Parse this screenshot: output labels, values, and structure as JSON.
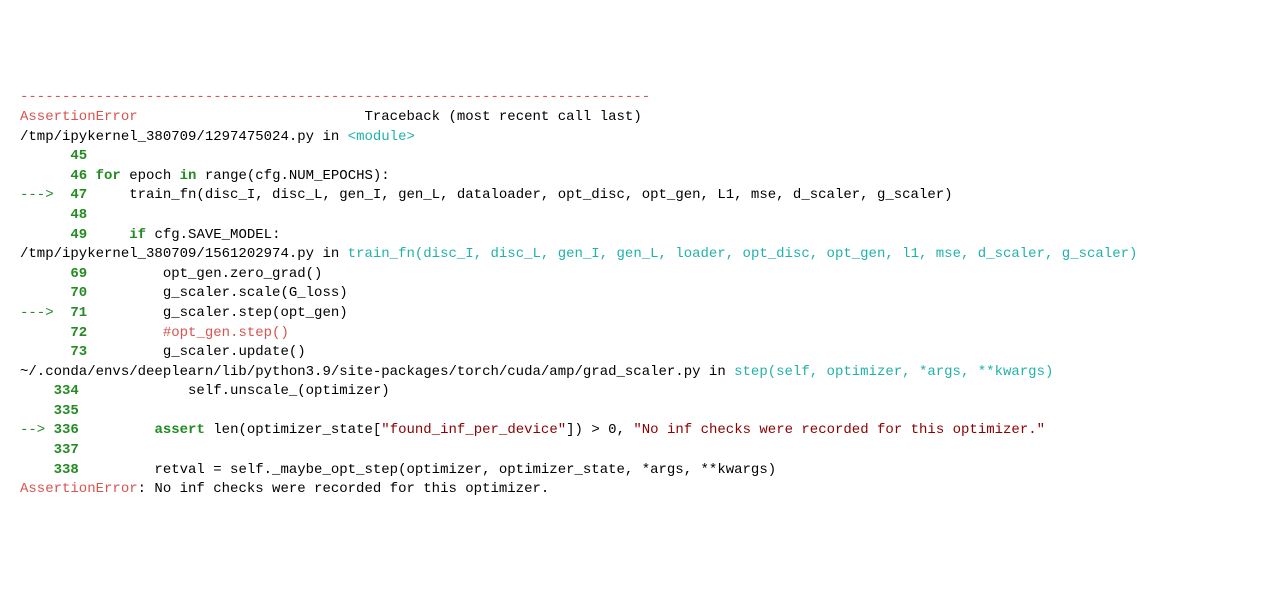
{
  "dash_line": "---------------------------------------------------------------------------",
  "header": {
    "error_name": "AssertionError",
    "spacer": "                           ",
    "traceback_label": "Traceback (most recent call last)"
  },
  "frames": [
    {
      "path": "/tmp/ipykernel_380709/1297475024.py",
      "in_word": " in ",
      "fn": "<module>",
      "lines": [
        {
          "arrow": "     ",
          "no": "45",
          "code": ""
        },
        {
          "arrow": "     ",
          "no": "46",
          "code_parts": [
            {
              "t": " ",
              "c": ""
            },
            {
              "t": "for",
              "c": "kw"
            },
            {
              "t": " epoch ",
              "c": ""
            },
            {
              "t": "in",
              "c": "kw"
            },
            {
              "t": " range(cfg.NUM_EPOCHS):",
              "c": ""
            }
          ]
        },
        {
          "arrow": "---> ",
          "no": "47",
          "code_parts": [
            {
              "t": "     train_fn(disc_I, disc_L, gen_I, gen_L, dataloader, opt_disc, opt_gen, L1, mse, d_scaler, g_scaler)",
              "c": ""
            }
          ]
        },
        {
          "arrow": "     ",
          "no": "48",
          "code": ""
        },
        {
          "arrow": "     ",
          "no": "49",
          "code_parts": [
            {
              "t": "     ",
              "c": ""
            },
            {
              "t": "if",
              "c": "kw"
            },
            {
              "t": " cfg.SAVE_MODEL:",
              "c": ""
            }
          ]
        }
      ]
    },
    {
      "path": "/tmp/ipykernel_380709/1561202974.py",
      "in_word": " in ",
      "fn": "train_fn(disc_I, disc_L, gen_I, gen_L, loader, opt_disc, opt_gen, l1, mse, d_scaler, g_scaler)",
      "lines": [
        {
          "arrow": "     ",
          "no": "69",
          "code_parts": [
            {
              "t": "         opt_gen.zero_grad()",
              "c": ""
            }
          ]
        },
        {
          "arrow": "     ",
          "no": "70",
          "code_parts": [
            {
              "t": "         g_scaler.scale(G_loss)",
              "c": ""
            }
          ]
        },
        {
          "arrow": "---> ",
          "no": "71",
          "code_parts": [
            {
              "t": "         g_scaler.step(opt_gen)",
              "c": ""
            }
          ]
        },
        {
          "arrow": "     ",
          "no": "72",
          "code_parts": [
            {
              "t": "         ",
              "c": ""
            },
            {
              "t": "#opt_gen.step()",
              "c": "comment"
            }
          ]
        },
        {
          "arrow": "     ",
          "no": "73",
          "code_parts": [
            {
              "t": "         g_scaler.update()",
              "c": ""
            }
          ]
        }
      ]
    },
    {
      "path": "~/.conda/envs/deeplearn/lib/python3.9/site-packages/torch/cuda/amp/grad_scaler.py",
      "in_word": " in ",
      "fn": "step(self, optimizer, *args, **kwargs)",
      "lines": [
        {
          "arrow": "    ",
          "no": "334",
          "code_parts": [
            {
              "t": "             self.unscale_(optimizer)",
              "c": ""
            }
          ]
        },
        {
          "arrow": "    ",
          "no": "335",
          "code_parts": [
            {
              "t": "",
              "c": ""
            }
          ]
        },
        {
          "arrow": "--> ",
          "no": "336",
          "code_parts": [
            {
              "t": "         ",
              "c": ""
            },
            {
              "t": "assert",
              "c": "kw"
            },
            {
              "t": " len(optimizer_state[",
              "c": ""
            },
            {
              "t": "\"found_inf_per_device\"",
              "c": "str"
            },
            {
              "t": "]) > ",
              "c": ""
            },
            {
              "t": "0",
              "c": "num"
            },
            {
              "t": ", ",
              "c": ""
            },
            {
              "t": "\"No inf checks were recorded for this optimizer.\"",
              "c": "str"
            }
          ]
        },
        {
          "arrow": "    ",
          "no": "337",
          "code_parts": [
            {
              "t": "",
              "c": ""
            }
          ]
        },
        {
          "arrow": "    ",
          "no": "338",
          "code_parts": [
            {
              "t": "         retval = self._maybe_opt_step(optimizer, optimizer_state, *args, **kwargs)",
              "c": ""
            }
          ]
        }
      ]
    }
  ],
  "final": {
    "error_name": "AssertionError",
    "message": ": No inf checks were recorded for this optimizer."
  }
}
